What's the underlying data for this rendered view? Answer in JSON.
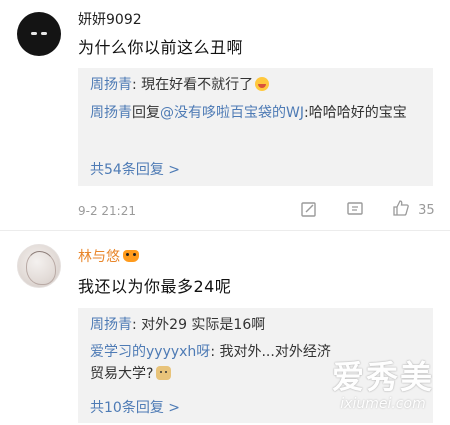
{
  "comments": [
    {
      "username": "妍妍9092",
      "text": "为什么你以前这么丑啊",
      "replies": [
        {
          "name": "周扬青",
          "sep": ": ",
          "content": "現在好看不就行了"
        },
        {
          "name": "周扬青",
          "reply_word": "回复",
          "mention": "@没有哆啦百宝袋的WJ",
          "sep": ":",
          "content": "哈哈哈好的宝宝"
        }
      ],
      "more_label": "共54条回复 >",
      "time": "9-2 21:21",
      "like_count": "35"
    },
    {
      "username": "林与悠",
      "text": "我还以为你最多24呢",
      "replies": [
        {
          "name": "周扬青",
          "sep": ": ",
          "content": "对外29 实际是16啊"
        },
        {
          "name": "爱学习的yyyyxh呀",
          "sep": ": ",
          "content": "我对外...对外经济贸易大学?"
        }
      ],
      "more_label": "共10条回复 >"
    }
  ],
  "watermark": {
    "main": "爱秀美",
    "sub": "ixiumei.com"
  },
  "colors": {
    "link": "#4e7bb5",
    "vip_name": "#e8862b",
    "reply_bg": "#f2f2f2",
    "meta": "#9a9a9a"
  },
  "icons": [
    "share-icon",
    "comment-icon",
    "like-icon",
    "grin-emoji-icon",
    "doge-emoji-icon",
    "vip-crown-icon"
  ]
}
